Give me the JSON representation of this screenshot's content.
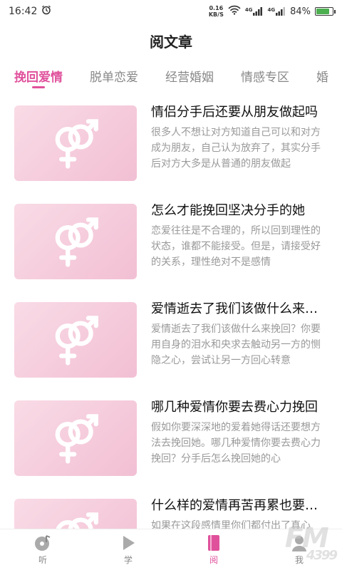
{
  "status_bar": {
    "time": "16:42",
    "speed_value": "0.16",
    "speed_unit": "KB/S",
    "network_1": "4G",
    "network_2": "4G",
    "battery_text": "84%",
    "battery_level": 0.84
  },
  "header": {
    "title": "阅文章"
  },
  "tabs": [
    {
      "label": "挽回爱情",
      "active": true
    },
    {
      "label": "脱单恋爱",
      "active": false
    },
    {
      "label": "经营婚姻",
      "active": false
    },
    {
      "label": "情感专区",
      "active": false
    },
    {
      "label": "婚",
      "active": false
    }
  ],
  "articles": [
    {
      "title": "情侣分手后还要从朋友做起吗",
      "desc": "很多人不想让对方知道自己可以和对方成为朋友，自己认为放弃了，其实分手后对方大多是从普通的朋友做起"
    },
    {
      "title": "怎么才能挽回坚决分手的她",
      "desc": "恋爱往往是不合理的，所以回到理性的状态，谁都不能接受。但是，请接受好的关系，理性绝对不是感情"
    },
    {
      "title": "爱情逝去了我们该做什么来挽回",
      "desc": "爱情逝去了我们该做什么来挽回？你要用自身的泪水和央求去触动另一方的恻隐之心，尝试让另一方回心转意"
    },
    {
      "title": "哪几种爱情你要去费心力挽回",
      "desc": "假如你要深深地的爱着她得话还要想方法去挽回她。哪几种爱情你要去费心力挽回？分手后怎么挽回她的心"
    },
    {
      "title": "什么样的爱情再苦再累也要挽回",
      "desc": "如果在这段感情里你们都付出了真心"
    }
  ],
  "bottom_nav": [
    {
      "label": "听",
      "icon": "vinyl-note-icon",
      "active": false
    },
    {
      "label": "学",
      "icon": "play-icon",
      "active": false
    },
    {
      "label": "阅",
      "icon": "book-icon",
      "active": true
    },
    {
      "label": "我",
      "icon": "user-icon",
      "active": false
    }
  ],
  "watermark": {
    "brand": "FM",
    "sub": "4399"
  },
  "colors": {
    "accent": "#e0519c",
    "thumb_bg": "#f4c7d8"
  }
}
